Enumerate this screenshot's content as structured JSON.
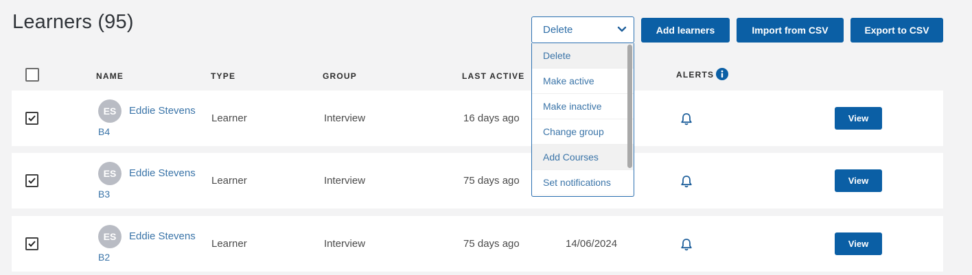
{
  "page": {
    "title": "Learners (95)"
  },
  "toolbar": {
    "bulk_action_selected": "Delete",
    "add_label": "Add learners",
    "import_label": "Import from CSV",
    "export_label": "Export to CSV"
  },
  "bulk_actions_menu": {
    "options": [
      "Delete",
      "Make active",
      "Make inactive",
      "Change group",
      "Add Courses",
      "Set notifications"
    ]
  },
  "table": {
    "headers": {
      "name": "NAME",
      "type": "TYPE",
      "group": "GROUP",
      "last_active": "LAST ACTIVE",
      "alerts": "ALERTS"
    },
    "rows": [
      {
        "initials": "ES",
        "name": "Eddie Stevens",
        "code": "B4",
        "type": "Learner",
        "group": "Interview",
        "last_active": "16 days ago",
        "date": "",
        "view_label": "View",
        "checked": true
      },
      {
        "initials": "ES",
        "name": "Eddie Stevens",
        "code": "B3",
        "type": "Learner",
        "group": "Interview",
        "last_active": "75 days ago",
        "date": "",
        "view_label": "View",
        "checked": true
      },
      {
        "initials": "ES",
        "name": "Eddie Stevens",
        "code": "B2",
        "type": "Learner",
        "group": "Interview",
        "last_active": "75 days ago",
        "date": "14/06/2024",
        "view_label": "View",
        "checked": true
      }
    ]
  },
  "colors": {
    "primary": "#0b5fa5",
    "link": "#3a74a8",
    "background": "#f3f3f4"
  },
  "icons": {
    "dropdown": "chevron-down-icon",
    "info": "info-icon",
    "alert": "bell-icon",
    "check": "check-icon"
  }
}
